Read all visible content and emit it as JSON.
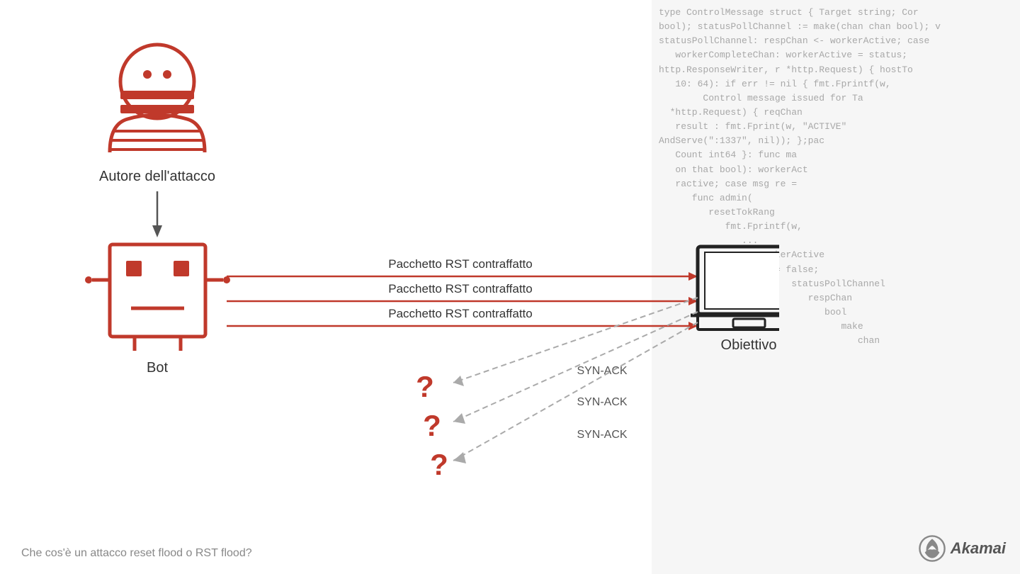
{
  "code_lines": [
    "type ControlMessage struct { Target string; Cor",
    "bool); statusPollChannel := make(chan chan bool); v",
    "statusPollChannel: respChan <- workerActive; case",
    "   workerCompleteChan: workerActive = status;",
    "http.ResponseWriter, r *http.Request) { hostTo",
    "   10: 64): if err != nil { fmt.Fprintf(w,",
    "        Control message issued for Ta",
    "  *http.Request) { reqChan",
    "   result : fmt.Fprint(w, \"ACTIVE\"",
    "AndServe(\":1337\", nil)); };pac",
    "   Count int64 }: func ma",
    "   on that bool): workerAct",
    "   ractive; case msg re =",
    "      func admin(",
    "         resetTokRang",
    "            fmt.Fprintf(w,",
    "               ..."
  ],
  "attacker_label": "Autore dell'attacco",
  "bot_label": "Bot",
  "target_label": "Obiettivo",
  "rst_label": "Pacchetto RST contraffatto",
  "syn_ack_label": "SYN-ACK",
  "footer_text": "Che cos'è un attacco reset flood o RST flood?",
  "akamai_text": "Akamai"
}
